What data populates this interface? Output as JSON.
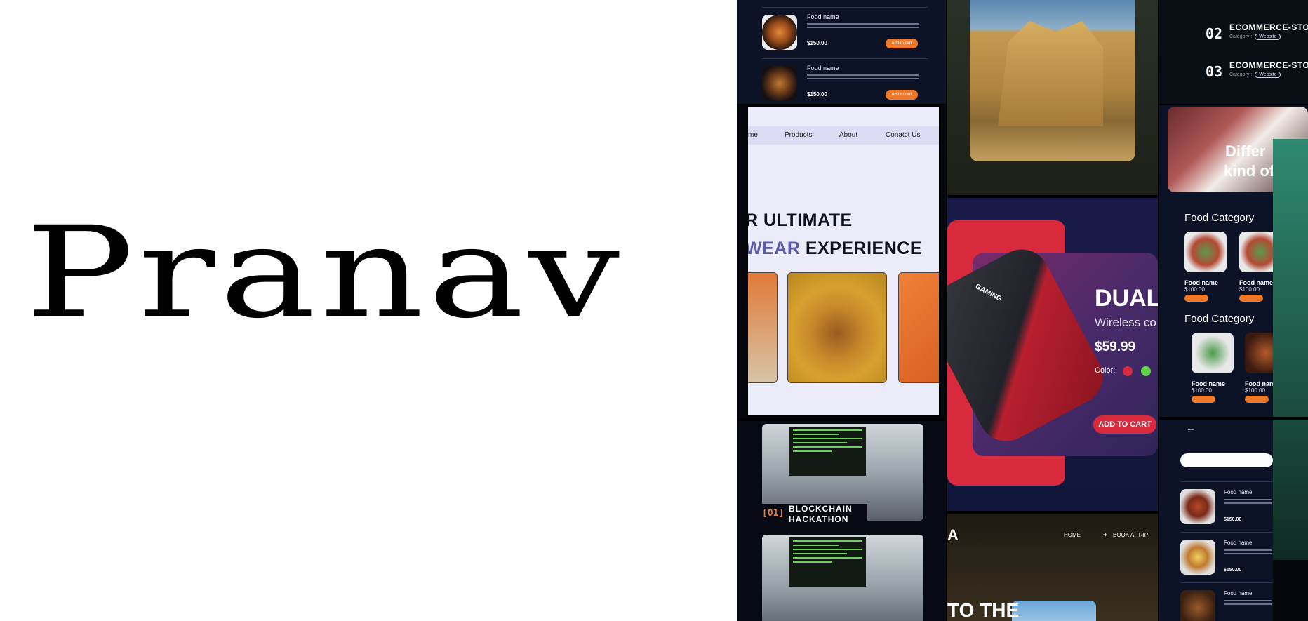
{
  "hero": {
    "name": "Pranav"
  },
  "collage": {
    "food_list": {
      "items": [
        {
          "name": "Food name",
          "price": "$150.00",
          "button": "Add to cart"
        },
        {
          "name": "Food name",
          "price": "$150.00",
          "button": "Add to cart"
        }
      ]
    },
    "ecommerce": {
      "items": [
        {
          "num": "02",
          "title": "ECOMMERCE-STORE",
          "category_label": "Category :",
          "category": "Website"
        },
        {
          "num": "03",
          "title": "ECOMMERCE-STORE",
          "category_label": "Category :",
          "category": "Website"
        }
      ]
    },
    "shoe_store": {
      "nav": [
        "me",
        "Products",
        "About",
        "Conatct Us"
      ],
      "headline_line1": "R ULTIMATE",
      "headline_accent": "WEAR",
      "headline_line2_rest": " EXPERIENCE"
    },
    "food_category": {
      "hero_line1": "Differ",
      "hero_line2": "kind of",
      "section1": "Food Category",
      "section2": "Food Category",
      "items": [
        {
          "name": "Food name",
          "price": "$100.00"
        },
        {
          "name": "Food name",
          "price": "$100.00"
        },
        {
          "name": "Food name",
          "price": "$100.00"
        },
        {
          "name": "Food nam",
          "price": "$100.00"
        }
      ]
    },
    "gaming": {
      "brand": "GAMING",
      "title": "DUAL",
      "subtitle": "Wireless co",
      "price": "$59.99",
      "color_label": "Color:",
      "colors": [
        "#d8293d",
        "#62d24a"
      ],
      "button": "ADD TO CART"
    },
    "hackathon": {
      "num": "[01]",
      "title_line1": "BLOCKCHAIN",
      "title_line2": "HACKATHON"
    },
    "travel": {
      "logo": "A",
      "nav": [
        "HOME",
        "BOOK A TRIP"
      ],
      "hero": "TO THE"
    },
    "food_list2": {
      "items": [
        {
          "name": "Food name",
          "price": "$150.00"
        },
        {
          "name": "Food name",
          "price": "$150.00"
        },
        {
          "name": "Food name",
          "price": ""
        }
      ]
    }
  }
}
